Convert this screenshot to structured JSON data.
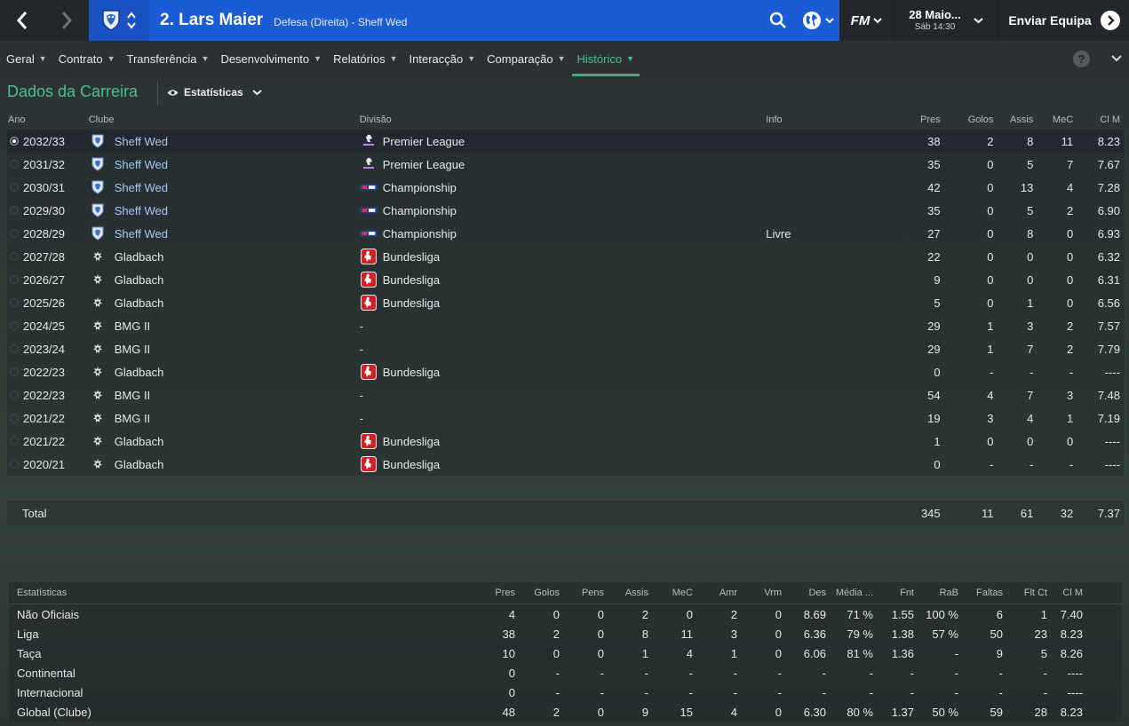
{
  "header": {
    "player_name": "2. Lars Maier",
    "player_subtitle": "Defesa (Direita) - Sheff Wed",
    "date_main": "28 Maio...",
    "date_sub": "Sáb 14:30",
    "send_label": "Enviar Equipa",
    "fm_label": "FM"
  },
  "tabs": [
    {
      "label": "Geral"
    },
    {
      "label": "Contrato"
    },
    {
      "label": "Transferência"
    },
    {
      "label": "Desenvolvimento"
    },
    {
      "label": "Relatórios"
    },
    {
      "label": "Interacção"
    },
    {
      "label": "Comparação"
    },
    {
      "label": "Histórico"
    }
  ],
  "active_tab": "Histórico",
  "section": {
    "title": "Dados da Carreira",
    "view_label": "Estatísticas"
  },
  "career": {
    "columns": {
      "year": "Ano",
      "club": "Clube",
      "division": "Divisão",
      "info": "Info",
      "pres": "Pres",
      "golos": "Golos",
      "assis": "Assis",
      "mec": "MeC",
      "clm": "Cl M"
    },
    "rows": [
      {
        "year": "2032/33",
        "club": "Sheff Wed",
        "club_icon": "owl-crest-icon",
        "division": "Premier League",
        "div_icon": "premier-league-icon",
        "info": "",
        "pres": "38",
        "golos": "2",
        "assis": "8",
        "mec": "11",
        "clm": "8.23"
      },
      {
        "year": "2031/32",
        "club": "Sheff Wed",
        "club_icon": "owl-crest-icon",
        "division": "Premier League",
        "div_icon": "premier-league-icon",
        "info": "",
        "pres": "35",
        "golos": "0",
        "assis": "5",
        "mec": "7",
        "clm": "7.67"
      },
      {
        "year": "2030/31",
        "club": "Sheff Wed",
        "club_icon": "owl-crest-icon",
        "division": "Championship",
        "div_icon": "championship-icon",
        "info": "",
        "pres": "42",
        "golos": "0",
        "assis": "13",
        "mec": "4",
        "clm": "7.28"
      },
      {
        "year": "2029/30",
        "club": "Sheff Wed",
        "club_icon": "owl-crest-icon",
        "division": "Championship",
        "div_icon": "championship-icon",
        "info": "",
        "pres": "35",
        "golos": "0",
        "assis": "5",
        "mec": "2",
        "clm": "6.90"
      },
      {
        "year": "2028/29",
        "club": "Sheff Wed",
        "club_icon": "owl-crest-icon",
        "division": "Championship",
        "div_icon": "championship-icon",
        "info": "Livre",
        "pres": "27",
        "golos": "0",
        "assis": "8",
        "mec": "0",
        "clm": "6.93"
      },
      {
        "year": "2027/28",
        "club": "Gladbach",
        "club_icon": "gladbach-crest-icon",
        "division": "Bundesliga",
        "div_icon": "bundesliga-icon",
        "info": "",
        "pres": "22",
        "golos": "0",
        "assis": "0",
        "mec": "0",
        "clm": "6.32"
      },
      {
        "year": "2026/27",
        "club": "Gladbach",
        "club_icon": "gladbach-crest-icon",
        "division": "Bundesliga",
        "div_icon": "bundesliga-icon",
        "info": "",
        "pres": "9",
        "golos": "0",
        "assis": "0",
        "mec": "0",
        "clm": "6.31"
      },
      {
        "year": "2025/26",
        "club": "Gladbach",
        "club_icon": "gladbach-crest-icon",
        "division": "Bundesliga",
        "div_icon": "bundesliga-icon",
        "info": "",
        "pres": "5",
        "golos": "0",
        "assis": "1",
        "mec": "0",
        "clm": "6.56"
      },
      {
        "year": "2024/25",
        "club": "BMG II",
        "club_icon": "gladbach-crest-icon",
        "division": "-",
        "div_icon": "",
        "info": "",
        "pres": "29",
        "golos": "1",
        "assis": "3",
        "mec": "2",
        "clm": "7.57"
      },
      {
        "year": "2023/24",
        "club": "BMG II",
        "club_icon": "gladbach-crest-icon",
        "division": "-",
        "div_icon": "",
        "info": "",
        "pres": "29",
        "golos": "1",
        "assis": "7",
        "mec": "2",
        "clm": "7.79"
      },
      {
        "year": "2022/23",
        "club": "Gladbach",
        "club_icon": "gladbach-crest-icon",
        "division": "Bundesliga",
        "div_icon": "bundesliga-icon",
        "info": "",
        "pres": "0",
        "golos": "-",
        "assis": "-",
        "mec": "-",
        "clm": "----"
      },
      {
        "year": "2022/23",
        "club": "BMG II",
        "club_icon": "gladbach-crest-icon",
        "division": "-",
        "div_icon": "",
        "info": "",
        "pres": "54",
        "golos": "4",
        "assis": "7",
        "mec": "3",
        "clm": "7.48"
      },
      {
        "year": "2021/22",
        "club": "BMG II",
        "club_icon": "gladbach-crest-icon",
        "division": "-",
        "div_icon": "",
        "info": "",
        "pres": "19",
        "golos": "3",
        "assis": "4",
        "mec": "1",
        "clm": "7.19"
      },
      {
        "year": "2021/22",
        "club": "Gladbach",
        "club_icon": "gladbach-crest-icon",
        "division": "Bundesliga",
        "div_icon": "bundesliga-icon",
        "info": "",
        "pres": "1",
        "golos": "0",
        "assis": "0",
        "mec": "0",
        "clm": "----"
      },
      {
        "year": "2020/21",
        "club": "Gladbach",
        "club_icon": "gladbach-crest-icon",
        "division": "Bundesliga",
        "div_icon": "bundesliga-icon",
        "info": "",
        "pres": "0",
        "golos": "-",
        "assis": "-",
        "mec": "-",
        "clm": "----"
      }
    ],
    "total": {
      "label": "Total",
      "pres": "345",
      "golos": "11",
      "assis": "61",
      "mec": "32",
      "clm": "7.37"
    }
  },
  "stats": {
    "columns": {
      "name": "Estatísticas",
      "pres": "Pres",
      "golos": "Golos",
      "pens": "Pens",
      "assis": "Assis",
      "mec": "MeC",
      "amr": "Amr",
      "vrm": "Vrm",
      "des": "Des",
      "media": "Média ...",
      "fnt": "Fnt",
      "rab": "RaB",
      "faltas": "Faltas",
      "fltct": "Flt Ct",
      "clm": "Cl M"
    },
    "rows": [
      {
        "name": "Não Oficiais",
        "pres": "4",
        "golos": "0",
        "pens": "0",
        "assis": "2",
        "mec": "0",
        "amr": "2",
        "vrm": "0",
        "des": "8.69",
        "media": "71 %",
        "fnt": "1.55",
        "rab": "100 %",
        "faltas": "6",
        "fltct": "1",
        "clm": "7.40"
      },
      {
        "name": "Liga",
        "pres": "38",
        "golos": "2",
        "pens": "0",
        "assis": "8",
        "mec": "11",
        "amr": "3",
        "vrm": "0",
        "des": "6.36",
        "media": "79 %",
        "fnt": "1.38",
        "rab": "57 %",
        "faltas": "50",
        "fltct": "23",
        "clm": "8.23"
      },
      {
        "name": "Taça",
        "pres": "10",
        "golos": "0",
        "pens": "0",
        "assis": "1",
        "mec": "4",
        "amr": "1",
        "vrm": "0",
        "des": "6.06",
        "media": "81 %",
        "fnt": "1.36",
        "rab": "-",
        "faltas": "9",
        "fltct": "5",
        "clm": "8.26"
      },
      {
        "name": "Continental",
        "pres": "0",
        "golos": "-",
        "pens": "-",
        "assis": "-",
        "mec": "-",
        "amr": "-",
        "vrm": "-",
        "des": "-",
        "media": "-",
        "fnt": "-",
        "rab": "-",
        "faltas": "-",
        "fltct": "-",
        "clm": "----"
      },
      {
        "name": "Internacional",
        "pres": "0",
        "golos": "-",
        "pens": "-",
        "assis": "-",
        "mec": "-",
        "amr": "-",
        "vrm": "-",
        "des": "-",
        "media": "-",
        "fnt": "-",
        "rab": "-",
        "faltas": "-",
        "fltct": "-",
        "clm": "----"
      },
      {
        "name": "Global (Clube)",
        "pres": "48",
        "golos": "2",
        "pens": "0",
        "assis": "9",
        "mec": "15",
        "amr": "4",
        "vrm": "0",
        "des": "6.30",
        "media": "80 %",
        "fnt": "1.37",
        "rab": "50 %",
        "faltas": "59",
        "fltct": "28",
        "clm": "8.23"
      }
    ]
  },
  "colors": {
    "accent_green": "#4cbf8c",
    "player_bar_blue": "#1c5bd6",
    "link_blue": "#a7c6f2"
  }
}
